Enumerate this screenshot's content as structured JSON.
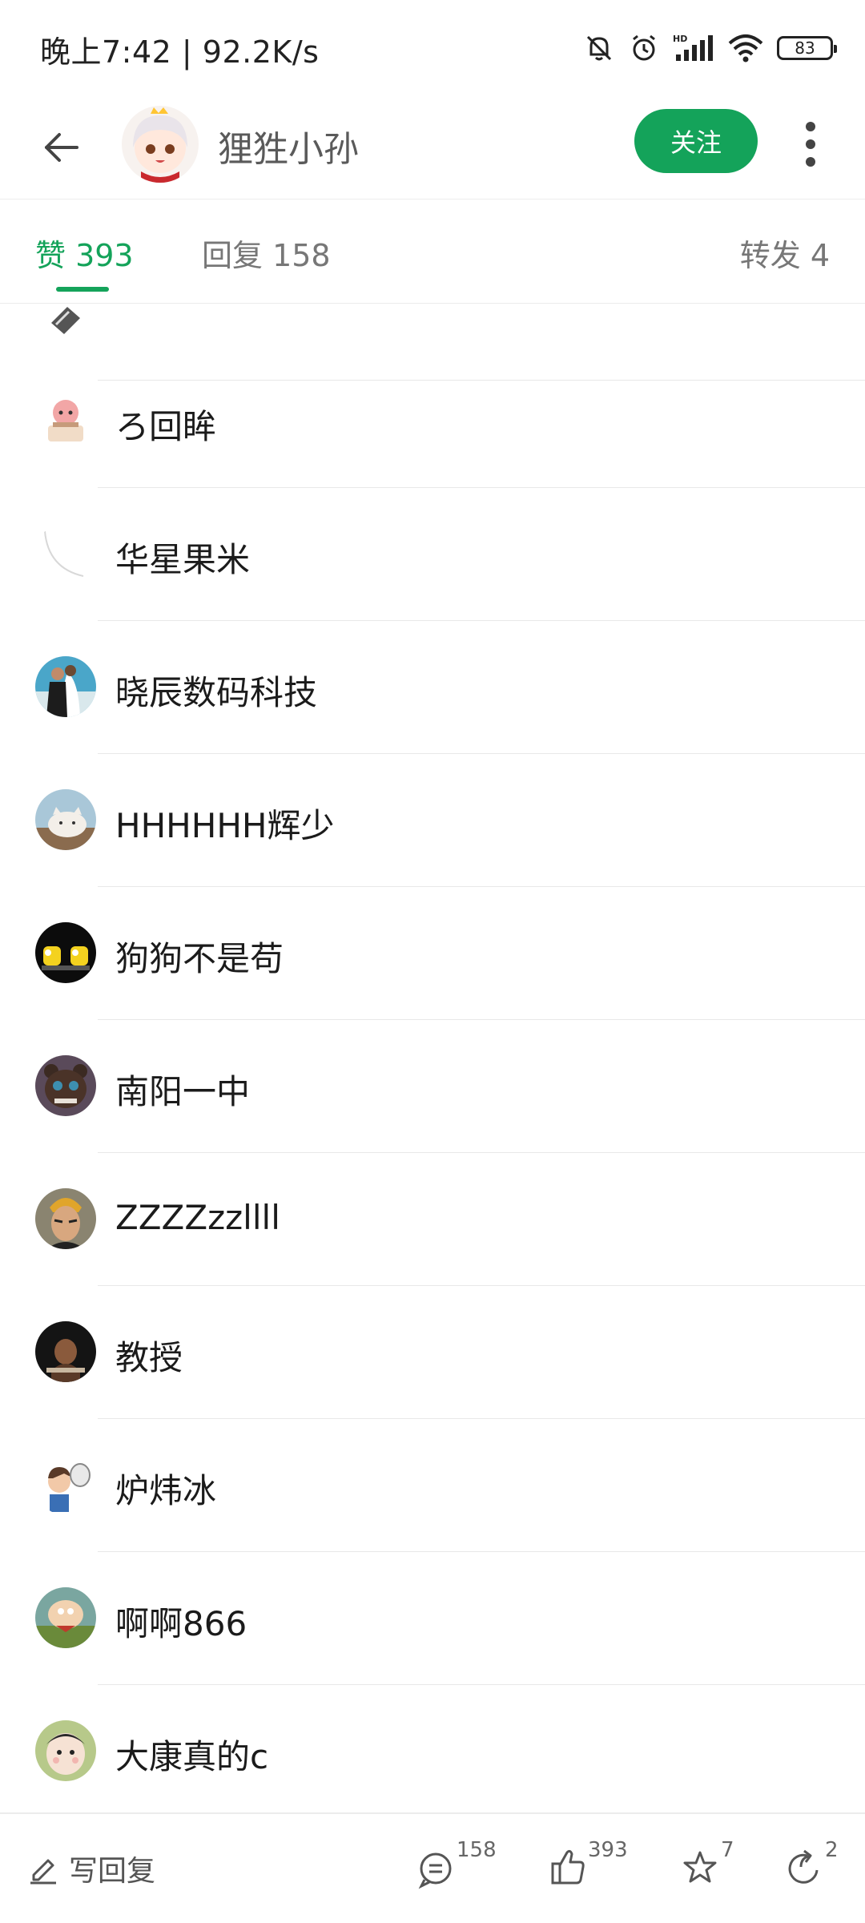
{
  "status_bar": {
    "time_speed": "晚上7:42 | 92.2K/s",
    "battery": "83"
  },
  "header": {
    "title": "狸狌小孙",
    "follow_label": "关注"
  },
  "tabs": {
    "likes": "赞 393",
    "replies": "回复 158",
    "reposts": "转发 4"
  },
  "list": {
    "items": [
      {
        "name": "ろ回眸"
      },
      {
        "name": "华星果米"
      },
      {
        "name": "晓辰数码科技"
      },
      {
        "name": "HHHHHH辉少"
      },
      {
        "name": "狗狗不是苟"
      },
      {
        "name": "南阳一中"
      },
      {
        "name": "ZZZZzzllll"
      },
      {
        "name": "教授"
      },
      {
        "name": "炉炜冰"
      },
      {
        "name": "啊啊866"
      },
      {
        "name": "大康真的c"
      }
    ]
  },
  "bottom_bar": {
    "reply_label": "写回复",
    "comment_count": "158",
    "like_count": "393",
    "favorite_count": "7",
    "share_count": "2"
  },
  "colors": {
    "accent": "#14a35a"
  }
}
